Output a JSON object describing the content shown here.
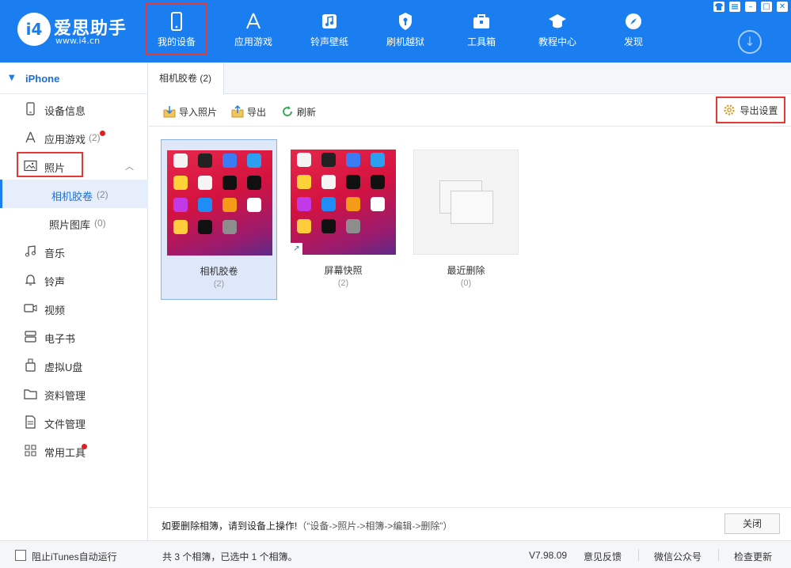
{
  "app": {
    "logo_mark": "i4",
    "logo_name": "爱思助手",
    "logo_url": "www.i4.cn"
  },
  "nav": [
    {
      "label": "我的设备",
      "icon": "phone-icon",
      "active": true
    },
    {
      "label": "应用游戏",
      "icon": "app-store-icon"
    },
    {
      "label": "铃声壁纸",
      "icon": "music-note-icon"
    },
    {
      "label": "刷机越狱",
      "icon": "shield-key-icon"
    },
    {
      "label": "工具箱",
      "icon": "toolbox-icon"
    },
    {
      "label": "教程中心",
      "icon": "graduation-cap-icon"
    },
    {
      "label": "发现",
      "icon": "compass-icon"
    }
  ],
  "window_controls": {
    "skin": "shirt-icon",
    "menu": "menu-icon",
    "minimize": "–",
    "maximize": "□",
    "close": "✕"
  },
  "download_glyph": "↓",
  "sidebar": {
    "device_name": "iPhone",
    "items": [
      {
        "label": "设备信息",
        "icon": "device-info-icon"
      },
      {
        "label": "应用游戏",
        "count": "(2)",
        "icon": "apps-icon",
        "dot": true
      },
      {
        "label": "照片",
        "icon": "photo-icon",
        "expanded": true
      },
      {
        "label": "相机胶卷",
        "count": "(2)",
        "sub": true,
        "active": true
      },
      {
        "label": "照片图库",
        "count": "(0)",
        "sub": true
      },
      {
        "label": "音乐",
        "icon": "music-icon"
      },
      {
        "label": "铃声",
        "icon": "bell-icon"
      },
      {
        "label": "视频",
        "icon": "video-icon"
      },
      {
        "label": "电子书",
        "icon": "ebook-icon"
      },
      {
        "label": "虚拟U盘",
        "icon": "usb-drive-icon"
      },
      {
        "label": "资料管理",
        "icon": "folder-icon"
      },
      {
        "label": "文件管理",
        "icon": "file-icon"
      },
      {
        "label": "常用工具",
        "icon": "grid-tools-icon",
        "dot": true
      }
    ]
  },
  "tab": {
    "label": "相机胶卷 (2)"
  },
  "toolbar": {
    "import_label": "导入照片",
    "export_label": "导出",
    "refresh_label": "刷新",
    "export_settings_label": "导出设置"
  },
  "albums": [
    {
      "name": "相机胶卷",
      "count": "(2)",
      "selected": true
    },
    {
      "name": "屏幕快照",
      "count": "(2)"
    },
    {
      "name": "最近删除",
      "count": "(0)"
    }
  ],
  "notice": {
    "text": "如要删除相簿，请到设备上操作!",
    "hint": "（“设备->照片->相簿->编辑->删除”）",
    "close_label": "关闭"
  },
  "status": {
    "itunes_label": "阻止iTunes自动运行",
    "summary": "共 3 个相簿，已选中 1 个相簿。",
    "version": "V7.98.09",
    "feedback": "意见反馈",
    "wechat": "微信公众号",
    "update": "检查更新"
  },
  "colors": {
    "brand": "#1b7ef0",
    "highlight_box": "#e53935",
    "selected_bg": "#dfe8f8",
    "red_dot": "#e02020"
  }
}
